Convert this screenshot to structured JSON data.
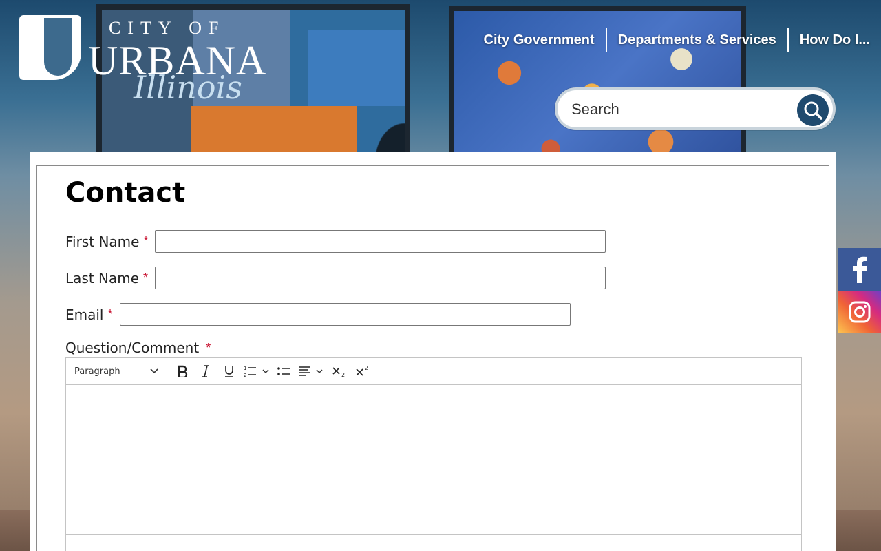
{
  "logo": {
    "line1": "CITY OF",
    "line2": "URBANA",
    "line3": "Illinois"
  },
  "nav": {
    "items": [
      "City Government",
      "Departments & Services",
      "How Do I..."
    ]
  },
  "search": {
    "placeholder": "Search"
  },
  "page": {
    "title": "Contact"
  },
  "form": {
    "first_name_label": "First Name",
    "last_name_label": "Last Name",
    "email_label": "Email",
    "question_label": "Question/Comment",
    "required_mark": "*"
  },
  "editor": {
    "format_select": "Paragraph"
  },
  "social": {
    "items": [
      "facebook-icon",
      "instagram-icon"
    ]
  }
}
